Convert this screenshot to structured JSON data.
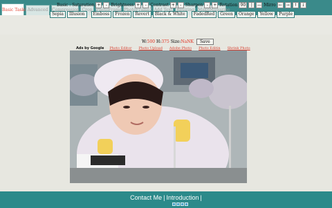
{
  "tabs": [
    {
      "label": "Basic Tasks",
      "active": true
    },
    {
      "label": "Advanced",
      "active": false
    },
    {
      "label": "Compression",
      "active": false
    },
    {
      "label": "Crop",
      "active": false
    },
    {
      "label": "PhotoFrame",
      "active": false
    },
    {
      "label": "PhotoFrame2",
      "active": false
    },
    {
      "label": "Add Text",
      "active": false
    },
    {
      "label": "Resizing",
      "active": false
    },
    {
      "label": "MakeMagazine",
      "active": false
    }
  ],
  "tools": {
    "basic_label": "Basic : Saturation",
    "brightness_label": "Brightness",
    "contrast_label": "Contrast",
    "sharpen_label": "Sharpen",
    "rotation_label": "Rotation",
    "rotation_value": "90",
    "mirror_label": "Mirro",
    "plus": "+",
    "minus": "-",
    "pipe": "|",
    "dash": "—",
    "arrow_left": "←",
    "arrow_right": "→",
    "arrow_up": "↑",
    "arrow_down": "↓",
    "effects": [
      "Sepia",
      "Illusion",
      "Emboss",
      "Frozen",
      "Revert",
      "Black & White",
      "FadedRed",
      "Green",
      "Orange",
      "Yellow",
      "Purple"
    ]
  },
  "size": {
    "w_label": "W:",
    "w_value": "500",
    "h_label": "H:",
    "h_value": "375",
    "size_label": "Size:",
    "size_value": "NaNK",
    "save_label": "Save"
  },
  "ads": {
    "label": "Ads by Google",
    "links": [
      "Photo Editor",
      "Photo Upload",
      "Adobe Photo",
      "Photo Editin",
      "Shrink Photo"
    ]
  },
  "footer": {
    "contact": "Contact Me",
    "separator": "|",
    "introduction": "Introduction",
    "end_separator": "|"
  },
  "pager": {
    "pages": 4
  },
  "colors": {
    "teal": "#3a8a8a",
    "active_tab_text": "#e34a3a",
    "link_red": "#d63a2a"
  }
}
